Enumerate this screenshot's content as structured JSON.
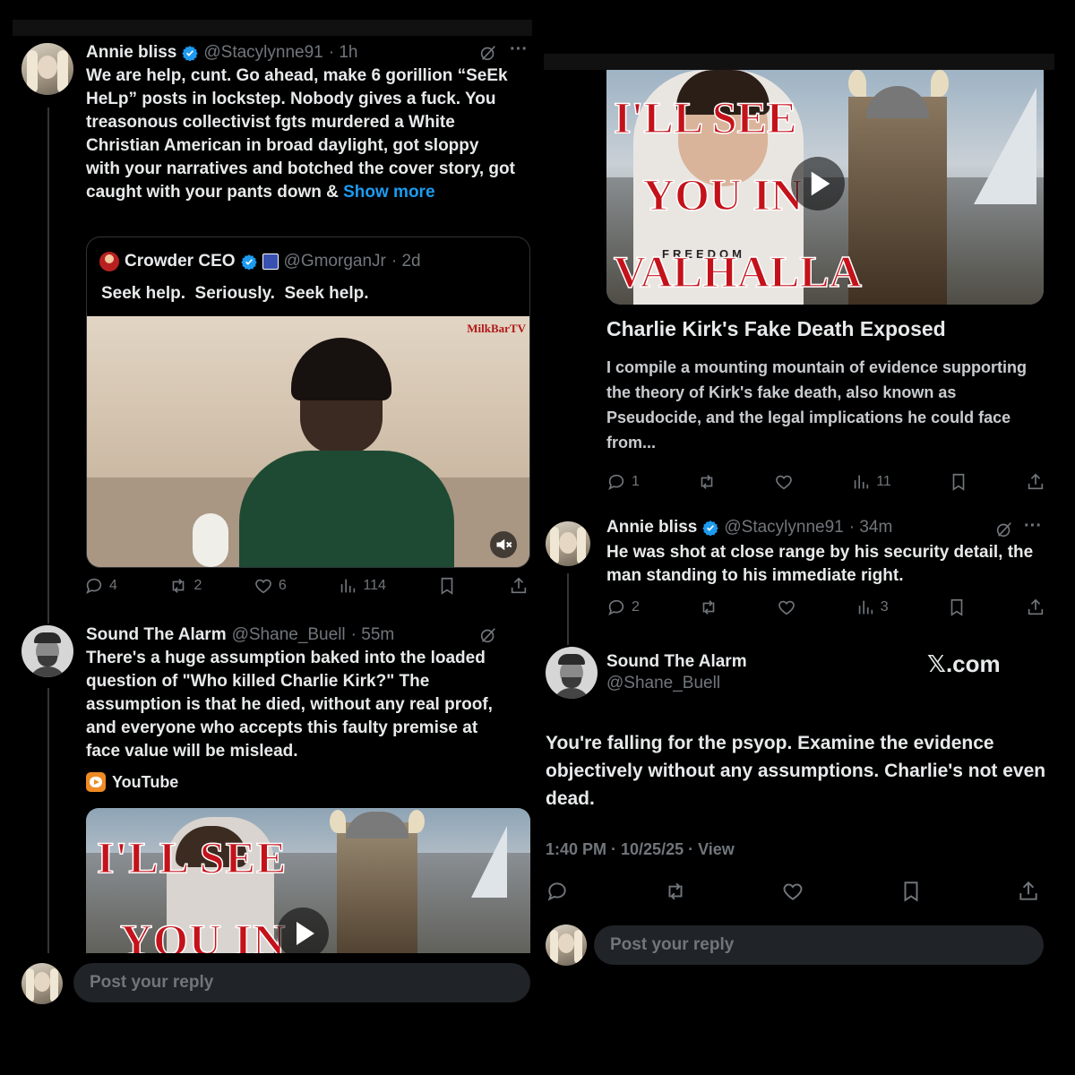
{
  "left": {
    "post1": {
      "name": "Annie bliss",
      "handle": "@Stacylynne91",
      "time": "· 1h",
      "text": "We are help, cunt. Go ahead, make 6 gorillion “SeEk HeLp” posts in lockstep. Nobody gives a fuck. You treasonous collectivist fgts murdered a White Christian American in broad daylight, got sloppy with your narratives and botched the cover story, got caught with your pants down &",
      "show_more": "Show more",
      "quote": {
        "name": "Crowder CEO",
        "handle": "@GmorganJr",
        "time": "· 2d",
        "text": "Seek help.  Seriously.  Seek help.",
        "watermark": "MilkBarTV"
      },
      "counts": {
        "replies": "4",
        "reposts": "2",
        "likes": "6",
        "views": "114"
      }
    },
    "post2": {
      "name": "Sound The Alarm",
      "handle": "@Shane_Buell",
      "time": "· 55m",
      "text": "There's a huge assumption baked into the loaded question of \"Who killed Charlie Kirk?\" The assumption is that he died, without any real proof, and everyone who accepts this faulty premise at face value will be mislead.",
      "source": "YouTube",
      "thumb_lines": [
        "I'LL SEE",
        "YOU IN"
      ]
    },
    "reply_placeholder": "Post your reply"
  },
  "right": {
    "card": {
      "thumb_lines": [
        "I'LL SEE",
        "YOU IN",
        "VALHALLA"
      ],
      "shirt": "FREEDOM",
      "title": "Charlie Kirk's Fake Death Exposed",
      "description": "I compile a mounting mountain of evidence supporting the theory of Kirk's fake death, also known as Pseudocide, and the legal implications he could face from...",
      "counts": {
        "replies": "1",
        "views": "11"
      }
    },
    "reply": {
      "name": "Annie bliss",
      "handle": "@Stacylynne91",
      "time": "· 34m",
      "text": "He was shot at close range by his security detail, the man standing to his immediate right.",
      "counts": {
        "replies": "2",
        "views": "3"
      }
    },
    "main": {
      "name": "Sound The Alarm",
      "handle": "@Shane_Buell",
      "site": "𝕏.com",
      "text": "You're falling for the psyop. Examine the evidence objectively without any assumptions. Charlie's not even dead.",
      "meta": "1:40 PM · 10/25/25 · View"
    },
    "reply_placeholder": "Post your reply"
  },
  "colors": {
    "accent": "#1d9bf0",
    "text": "#e7e9ea",
    "muted": "#71767b",
    "bg": "#000000"
  }
}
